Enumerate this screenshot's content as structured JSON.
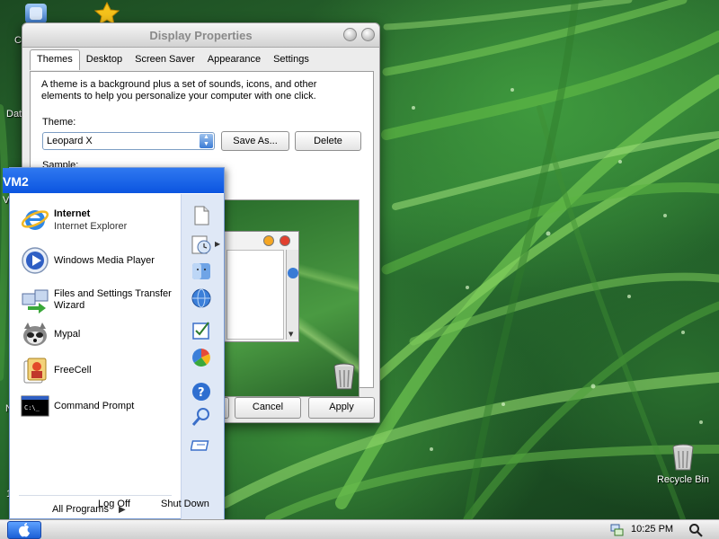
{
  "desktop": {
    "icons": [
      {
        "label": "Recycle Bin",
        "icon": "recycle-bin-icon"
      }
    ],
    "partial_labels": [
      "Co",
      "Dat",
      "V",
      "N",
      "1"
    ]
  },
  "window": {
    "title": "Display Properties",
    "tabs": [
      "Themes",
      "Desktop",
      "Screen Saver",
      "Appearance",
      "Settings"
    ],
    "active_tab": "Themes",
    "description": "A theme is a background plus a set of sounds, icons, and other elements to help you personalize your computer with one click.",
    "theme_label": "Theme:",
    "theme_value": "Leopard X",
    "save_as_label": "Save As...",
    "delete_label": "Delete",
    "sample_label": "Sample:",
    "ok_label": "OK",
    "cancel_label": "Cancel",
    "apply_label": "Apply"
  },
  "start_menu": {
    "user_name": "VM2",
    "items": [
      {
        "title": "Internet",
        "subtitle": "Internet Explorer",
        "icon": "internet-explorer-icon"
      },
      {
        "title": "Windows Media Player",
        "icon": "media-player-icon"
      },
      {
        "title": "Files and Settings Transfer Wizard",
        "icon": "transfer-wizard-icon"
      },
      {
        "title": "Mypal",
        "icon": "mypal-icon"
      },
      {
        "title": "FreeCell",
        "icon": "freecell-icon"
      },
      {
        "title": "Command Prompt",
        "icon": "command-prompt-icon"
      }
    ],
    "right_icons": [
      "document-icon",
      "recent-clock-icon",
      "finder-icon",
      "network-globe-icon",
      "control-panel-icon",
      "color-wheel-icon",
      "help-icon",
      "search-icon",
      "run-icon"
    ],
    "all_programs_label": "All Programs",
    "log_off_label": "Log Off",
    "shut_down_label": "Shut Down"
  },
  "taskbar": {
    "clock": "10:25 PM",
    "start_icon": "apple-start-icon",
    "tray_icons": [
      "network-tray-icon",
      "search-icon"
    ]
  }
}
